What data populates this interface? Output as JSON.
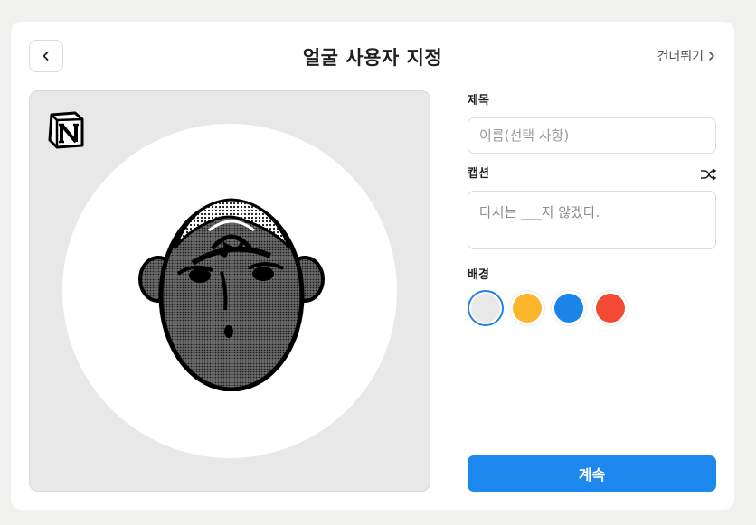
{
  "header": {
    "title": "얼굴 사용자 지정",
    "skip_label": "건너뛰기"
  },
  "form": {
    "title_label": "제목",
    "title_placeholder": "이름(선택 사항)",
    "caption_label": "캡션",
    "caption_placeholder": "다시는 ___지 않겠다.",
    "background_label": "배경",
    "background_colors": [
      {
        "name": "light-gray",
        "hex": "#e9e8e8",
        "selected": true
      },
      {
        "name": "yellow",
        "hex": "#fbb62c",
        "selected": false
      },
      {
        "name": "blue",
        "hex": "#1a84e8",
        "selected": false
      },
      {
        "name": "red",
        "hex": "#f24a33",
        "selected": false
      }
    ]
  },
  "footer": {
    "continue_label": "계속"
  },
  "icons": {
    "back": "chevron-left-icon",
    "skip": "chevron-right-icon",
    "shuffle": "shuffle-icon",
    "logo": "notion-logo"
  },
  "colors": {
    "accent": "#1c87ed",
    "preview_background": "#e9e8e8"
  }
}
